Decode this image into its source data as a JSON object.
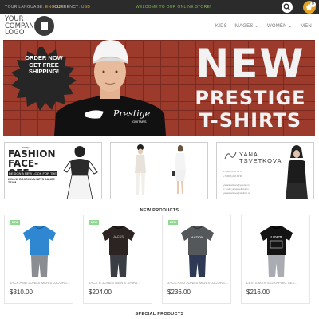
{
  "topbar": {
    "language_label": "Your Language:",
    "language_value": "English",
    "currency_label": "Currency:",
    "currency_value": "USD",
    "welcome": "Welcome to our online store!",
    "cart_count": "0"
  },
  "header": {
    "logo_text": [
      "YOUR",
      "COMPANY",
      "LOGO"
    ],
    "nav": [
      {
        "label": "Kids"
      },
      {
        "label": "Images"
      },
      {
        "label": "Women"
      },
      {
        "label": "Men"
      }
    ]
  },
  "banner": {
    "burst": [
      "Order now",
      "get free",
      "shipping!"
    ],
    "shirt_brand": "Prestige",
    "shirt_sub": "GUITARS",
    "headline": "NEW",
    "line2": "PRESTIGE",
    "line3": "T-SHIRTS"
  },
  "promos": {
    "tile1": {
      "small": "Jersey",
      "title": [
        "Fashion",
        "Face-Off"
      ],
      "strip": "Design a new look for the",
      "sub": "2014-15 Brooklyn Nets Dance Team"
    },
    "tile3": {
      "name": [
        "Yana",
        "Tsvetkova"
      ],
      "lines": [
        "+7 (903) 222 55 77",
        "+7 (903) 256 44 98",
        "yanatsvetkova@yandex.ru",
        "v. mode.yanatsvetkova.ru",
        "yanatsvetkova@rambler.ru"
      ]
    }
  },
  "sections": {
    "new_products": "New Products",
    "special_products": "Special Products"
  },
  "products": [
    {
      "badge": "New",
      "name": "Jack and Jones Men's Jjcore...",
      "price": "$310.00",
      "shirt_color": "#2f86d1",
      "print": ""
    },
    {
      "badge": "New",
      "name": "Jack & Jones Men's Shirt...",
      "price": "$204.00",
      "shirt_color": "#2b2422",
      "print": "JACKS"
    },
    {
      "badge": "New",
      "name": "Jack and Jones Men's Jjcore...",
      "price": "$236.00",
      "shirt_color": "#55585b",
      "print": "ACTION"
    },
    {
      "badge": "",
      "name": "Levi's Men's Graphic Set...",
      "price": "$216.00",
      "shirt_color": "#141414",
      "print": "LEVI'S"
    }
  ],
  "colors": {
    "topbar_bg": "#2b2b2b",
    "accent": "#e6a323",
    "welcome": "#7cc04f",
    "new_badge": "#8fd88f",
    "brick": "#9c3b2c"
  },
  "icons": [
    "search-icon",
    "cart-icon",
    "logo-square-icon",
    "chevron-down-icon",
    "starburst"
  ]
}
